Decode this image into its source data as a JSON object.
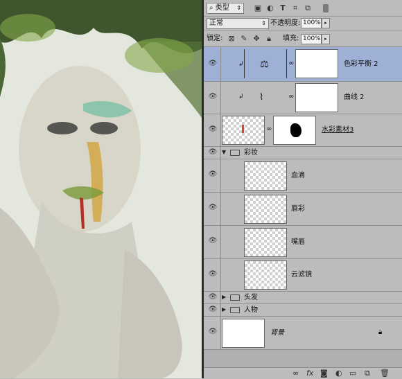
{
  "toolbar": {
    "filter_label": "类型",
    "blend_mode": "正常",
    "opacity_label": "不透明度:",
    "opacity_value": "100%",
    "lock_label": "锁定:",
    "fill_label": "填充:",
    "fill_value": "100%"
  },
  "layers": [
    {
      "name": "色彩平衡 2",
      "active": true
    },
    {
      "name": "曲线 2",
      "active": false
    },
    {
      "name": "水彩素材3",
      "active": false
    },
    {
      "name": "彩妆",
      "group": true,
      "expanded": true
    },
    {
      "name": "血滴",
      "active": false
    },
    {
      "name": "唇彩",
      "active": false
    },
    {
      "name": "嘴唇",
      "active": false
    },
    {
      "name": "云滤镜",
      "active": false
    },
    {
      "name": "头发",
      "group": true,
      "expanded": false
    },
    {
      "name": "人物",
      "group": true,
      "expanded": false
    },
    {
      "name": "背景",
      "active": false,
      "locked": true
    }
  ],
  "colors": {
    "active_row": "#9fb0d6",
    "panel_bg": "#bcbcbc"
  },
  "icons": [
    "search-icon",
    "image-filter-icon",
    "adjustment-filter-icon",
    "text-filter-icon",
    "shape-filter-icon",
    "smart-object-filter-icon",
    "lock-transparent-icon",
    "lock-brush-icon",
    "lock-move-icon",
    "lock-all-icon",
    "eye-icon",
    "link-icon",
    "fx-icon",
    "mask-icon",
    "new-adjustment-icon",
    "new-group-icon",
    "new-layer-icon",
    "trash-icon",
    "lock-icon",
    "balance-icon",
    "curves-icon"
  ]
}
